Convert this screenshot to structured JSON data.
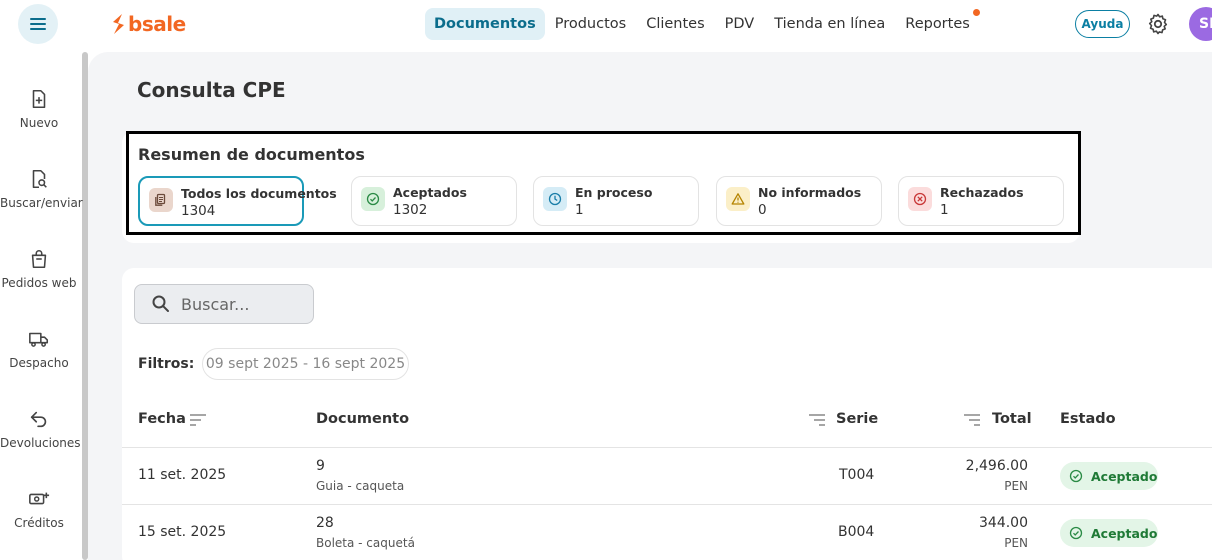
{
  "brand": {
    "name": "bsale",
    "color": "#f26722"
  },
  "nav": {
    "items": [
      {
        "label": "Documentos",
        "active": true
      },
      {
        "label": "Productos"
      },
      {
        "label": "Clientes"
      },
      {
        "label": "PDV"
      },
      {
        "label": "Tienda en línea"
      },
      {
        "label": "Reportes",
        "dot": true
      }
    ],
    "help_label": "Ayuda",
    "avatar_initials": "SI"
  },
  "sidebar": {
    "items": [
      {
        "label": "Nuevo",
        "icon": "file-plus-icon"
      },
      {
        "label": "Buscar/enviar",
        "icon": "file-search-icon"
      },
      {
        "label": "Pedidos web",
        "icon": "shopping-bag-icon"
      },
      {
        "label": "Despacho",
        "icon": "truck-icon"
      },
      {
        "label": "Devoluciones",
        "icon": "return-arrow-icon"
      },
      {
        "label": "Créditos",
        "icon": "cash-plus-icon"
      }
    ]
  },
  "page": {
    "title": "Consulta CPE"
  },
  "summary": {
    "title": "Resumen de documentos",
    "cards": [
      {
        "label": "Todos los documentos",
        "count": "1304",
        "icon": "documents-icon",
        "selected": true
      },
      {
        "label": "Aceptados",
        "count": "1302",
        "icon": "check-circle-icon"
      },
      {
        "label": "En proceso",
        "count": "1",
        "icon": "clock-icon"
      },
      {
        "label": "No informados",
        "count": "0",
        "icon": "warning-icon"
      },
      {
        "label": "Rechazados",
        "count": "1",
        "icon": "x-circle-icon"
      }
    ]
  },
  "search": {
    "placeholder": "Buscar..."
  },
  "filters": {
    "label": "Filtros:",
    "date_range": "09 sept 2025 - 16 sept 2025"
  },
  "table": {
    "columns": {
      "fecha": "Fecha",
      "documento": "Documento",
      "serie": "Serie",
      "total": "Total",
      "estado": "Estado"
    },
    "rows": [
      {
        "fecha": "11 set. 2025",
        "doc_number": "9",
        "doc_desc": "Guia - caqueta",
        "serie": "T004",
        "total": "2,496.00",
        "currency": "PEN",
        "estado": "Aceptado"
      },
      {
        "fecha": "15 set. 2025",
        "doc_number": "28",
        "doc_desc": "Boleta - caquetá",
        "serie": "B004",
        "total": "344.00",
        "currency": "PEN",
        "estado": "Aceptado"
      }
    ]
  },
  "colors": {
    "accent": "#0b7fa3",
    "success_bg": "#e3f5e7",
    "success_text": "#1f7a36"
  }
}
